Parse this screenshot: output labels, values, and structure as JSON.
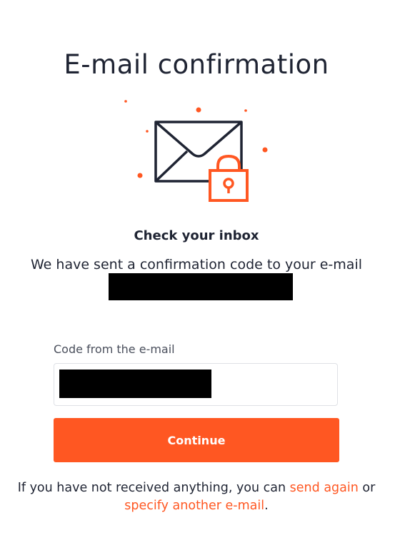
{
  "header": {
    "title": "E-mail confirmation"
  },
  "illustration": {
    "icon": "envelope-with-lock",
    "stroke_color": "#1f2433",
    "accent_color": "#ff5722"
  },
  "message": {
    "subtitle": "Check your inbox",
    "sent_text": "We have sent a confirmation code to your e-mail"
  },
  "form": {
    "code_label": "Code from the e-mail",
    "continue_label": "Continue"
  },
  "footer": {
    "prefix": "If you have not received anything, you can ",
    "send_again_link": "send again",
    "middle": " or",
    "specify_link": "specify another e-mail",
    "suffix": "."
  },
  "colors": {
    "accent": "#ff5722",
    "text": "#1f2433"
  }
}
